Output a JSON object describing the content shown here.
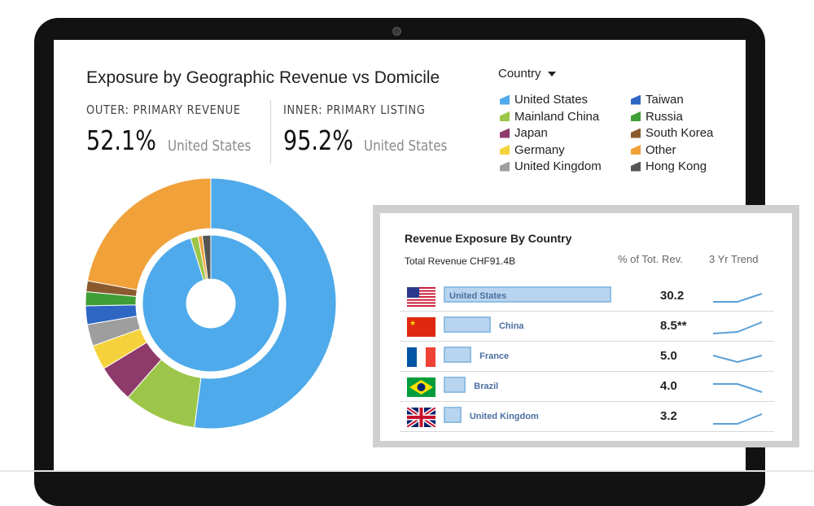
{
  "header": {
    "title": "Exposure by Geographic Revenue vs Domicile",
    "outer_label": "OUTER: PRIMARY REVENUE",
    "outer_pct": "52.1%",
    "outer_country": "United States",
    "inner_label": "INNER: PRIMARY LISTING",
    "inner_pct": "95.2%",
    "inner_country": "United States"
  },
  "filter": {
    "label": "Country"
  },
  "legend": [
    {
      "name": "United States",
      "color": "#4eaaea"
    },
    {
      "name": "Mainland China",
      "color": "#9cc64a"
    },
    {
      "name": "Japan",
      "color": "#8e3a6b"
    },
    {
      "name": "Germany",
      "color": "#f5d23c"
    },
    {
      "name": "United Kingdom",
      "color": "#9e9e9e"
    },
    {
      "name": "Taiwan",
      "color": "#2e66c4"
    },
    {
      "name": "Russia",
      "color": "#3f9e35"
    },
    {
      "name": "South Korea",
      "color": "#8a5a2e"
    },
    {
      "name": "Other",
      "color": "#f0a13a"
    },
    {
      "name": "Hong Kong",
      "color": "#555555"
    }
  ],
  "chart_data": [
    {
      "type": "pie",
      "title": "Exposure by Geographic Revenue vs Domicile",
      "series": [
        {
          "name": "OUTER: PRIMARY REVENUE",
          "labels": [
            "United States",
            "Mainland China",
            "Japan",
            "Germany",
            "United Kingdom",
            "Taiwan",
            "Russia",
            "South Korea",
            "Other"
          ],
          "values": [
            52.1,
            9.4,
            4.8,
            3.2,
            2.8,
            2.4,
            1.8,
            1.4,
            22.1
          ]
        },
        {
          "name": "INNER: PRIMARY LISTING",
          "labels": [
            "United States",
            "Mainland China",
            "Other",
            "Hong Kong"
          ],
          "values": [
            95.2,
            1.8,
            1.0,
            2.0
          ]
        }
      ]
    },
    {
      "type": "bar",
      "title": "Revenue Exposure By Country",
      "subtitle": "Total Revenue CHF91.4B",
      "categories": [
        "United States",
        "China",
        "France",
        "Brazil",
        "United Kingdom"
      ],
      "values": [
        30.2,
        8.5,
        5.0,
        4.0,
        3.2
      ],
      "value_labels": [
        "30.2",
        "8.5**",
        "5.0",
        "4.0",
        "3.2"
      ],
      "value_header": "% of Tot. Rev.",
      "trend_header": "3 Yr Trend",
      "trends": [
        [
          0.2,
          0.2,
          0.7
        ],
        [
          0.1,
          0.2,
          0.8
        ],
        [
          0.6,
          0.2,
          0.6
        ],
        [
          0.7,
          0.7,
          0.2
        ],
        [
          0.1,
          0.1,
          0.7
        ]
      ]
    }
  ],
  "panel": {
    "title": "Revenue Exposure By Country",
    "subtitle": "Total Revenue CHF91.4B",
    "value_header": "% of Tot. Rev.",
    "trend_header": "3 Yr Trend",
    "rows": [
      {
        "label": "United States",
        "value": "30.2",
        "flag": "us-flag"
      },
      {
        "label": "China",
        "value": "8.5**",
        "flag": "china-flag"
      },
      {
        "label": "France",
        "value": "5.0",
        "flag": "france-flag"
      },
      {
        "label": "Brazil",
        "value": "4.0",
        "flag": "brazil-flag"
      },
      {
        "label": "United Kingdom",
        "value": "3.2",
        "flag": "uk-flag"
      }
    ]
  }
}
